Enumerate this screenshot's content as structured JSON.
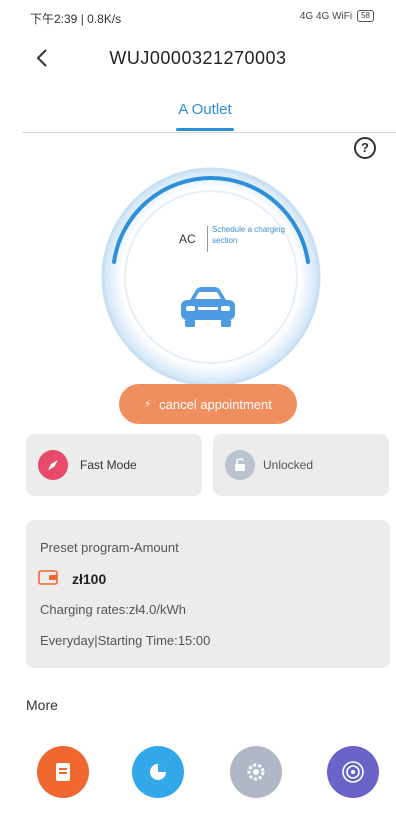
{
  "status_bar": {
    "time_speed": "下午2:39 | 0.8K/s",
    "right_indicators": "4G 4G WiFi",
    "battery": "58"
  },
  "header": {
    "title": "WUJ0000321270003"
  },
  "tabs": [
    {
      "label": "A Outlet",
      "active": true
    }
  ],
  "gauge": {
    "mode": "AC",
    "schedule_text": "Schedule a charging section"
  },
  "cancel_button": {
    "label": "cancel appointment",
    "color": "#ef8f5f"
  },
  "mode_cards": {
    "fast_mode": {
      "label": "Fast Mode",
      "icon": "rocket-icon",
      "color": "#e84a6c"
    },
    "unlocked": {
      "label": "Unlocked",
      "icon": "lock-open-icon",
      "color": "#bcc3d0"
    }
  },
  "preset": {
    "title": "Preset program-Amount",
    "amount": "zł100",
    "rates": "Charging rates:zł4.0/kWh",
    "schedule": "Everyday|Starting Time:15:00"
  },
  "more": {
    "title": "More",
    "apps": [
      {
        "label": "",
        "icon": "document-icon",
        "color": "#f0672f"
      },
      {
        "label": "",
        "icon": "chart-icon",
        "color": "#33a8e8"
      },
      {
        "label": "",
        "icon": "gear-icon",
        "color": "#b0b7c6"
      },
      {
        "label": "",
        "icon": "signal-icon",
        "color": "#6a64c8"
      }
    ]
  },
  "accent_color": "#2d8fd9"
}
